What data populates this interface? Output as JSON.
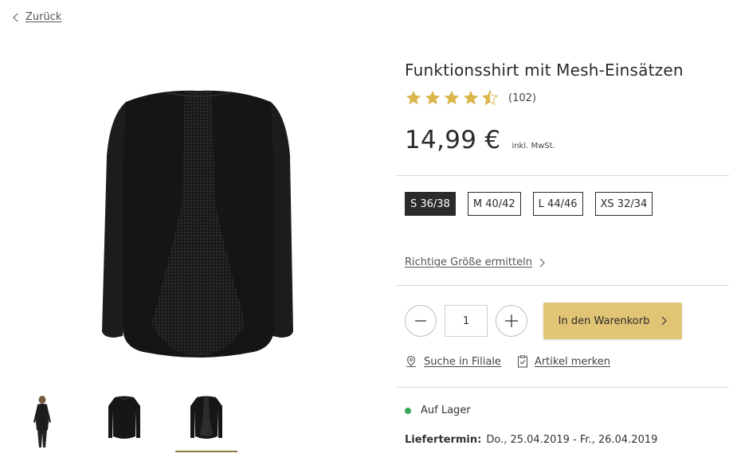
{
  "nav": {
    "back_label": "Zurück"
  },
  "product": {
    "title": "Funktionsshirt mit Mesh-Einsätzen",
    "rating": {
      "value": 4.5,
      "max": 5,
      "count": "(102)"
    },
    "price": "14,99 €",
    "vat_note": "inkl. MwSt."
  },
  "sizes": [
    {
      "label": "S 36/38",
      "selected": true
    },
    {
      "label": "M 40/42",
      "selected": false
    },
    {
      "label": "L 44/46",
      "selected": false
    },
    {
      "label": "XS 32/34",
      "selected": false
    }
  ],
  "size_help": {
    "label": "Richtige Größe ermitteln"
  },
  "quantity": {
    "value": "1"
  },
  "cart": {
    "label": "In den Warenkorb"
  },
  "actions": {
    "store_search": "Suche in Filiale",
    "wishlist": "Artikel merken"
  },
  "availability": {
    "status": "Auf Lager",
    "color": "#3aa55c"
  },
  "delivery": {
    "label": "Liefertermin:",
    "value": "Do., 25.04.2019 - Fr., 26.04.2019"
  },
  "colors": {
    "accent": "#e2c475",
    "star": "#d9b54a",
    "dark": "#2b2b2b"
  }
}
